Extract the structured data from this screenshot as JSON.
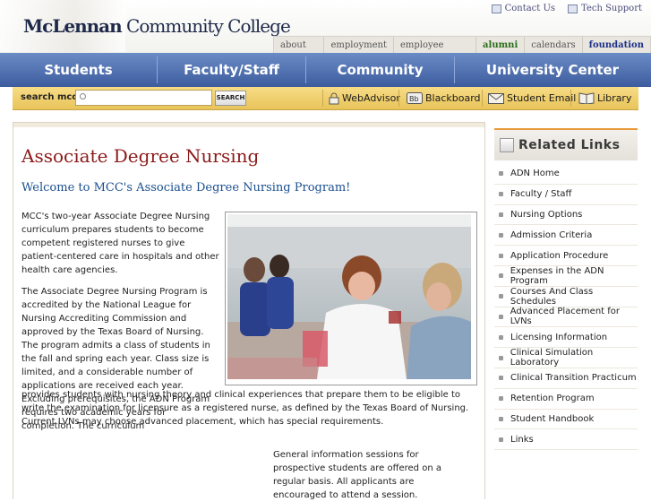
{
  "header": {
    "logo_bold": "McLennan",
    "logo_rest": " Community College",
    "util_links": [
      "Contact Us",
      "Tech Support"
    ],
    "top_nav": [
      "about mcc",
      "employment",
      "employee directory",
      "alumni",
      "calendars",
      "foundation"
    ]
  },
  "main_nav": [
    "Students",
    "Faculty/Staff",
    "Community",
    "University Center"
  ],
  "search": {
    "label": "search mcc:",
    "value": "",
    "button": "SEARCH"
  },
  "quick_links": [
    {
      "label": "WebAdvisor",
      "icon": "lock-icon"
    },
    {
      "label": "Blackboard",
      "icon": "blackboard-icon"
    },
    {
      "label": "Student Email",
      "icon": "envelope-icon"
    },
    {
      "label": "Library",
      "icon": "book-icon"
    }
  ],
  "content": {
    "title": "Associate Degree Nursing",
    "subtitle": "Welcome to MCC's Associate Degree Nursing Program!",
    "para1": "MCC's two-year Associate Degree Nursing curriculum prepares students to become competent registered nurses to give patient-centered care in hospitals and other health care agencies.",
    "para2_narrow": "The Associate Degree Nursing Program is accredited by the National League for Nursing Accrediting Commission and approved by the Texas Board of Nursing. The program admits a class of students in the fall and spring each year. Class size is limited, and a considerable number of applications are received each year. Excluding prerequisites, the ADN Program requires two academic years for completion. The curriculum",
    "para2_wide": "provides students with nursing theory and clinical experiences that prepare them to be eligible to write the examination for licensure as a registered nurse, as defined by the Texas Board of Nursing. Current LVNs may choose advanced placement, which has special requirements.",
    "para3": "General information sessions for prospective students are offered on a regular basis. All applicants are encouraged to attend a session."
  },
  "sidebar": {
    "heading": "Related Links",
    "links": [
      "ADN Home",
      "Faculty / Staff",
      "Nursing Options",
      "Admission Criteria",
      "Application Procedure",
      "Expenses in the ADN Program",
      "Courses And Class Schedules",
      "Advanced Placement for LVNs",
      "Licensing Information",
      "Clinical Simulation Laboratory",
      "Clinical Transition Practicum",
      "Retention Program",
      "Student Handbook",
      "Links"
    ]
  }
}
